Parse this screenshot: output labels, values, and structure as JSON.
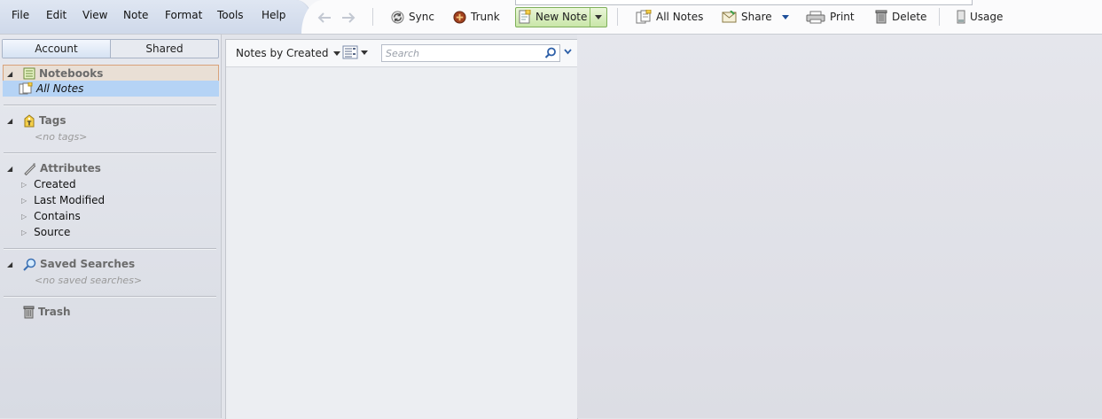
{
  "menubar": {
    "items": [
      "File",
      "Edit",
      "View",
      "Note",
      "Format",
      "Tools",
      "Help"
    ]
  },
  "toolbar": {
    "back_icon": "arrow-left-icon",
    "forward_icon": "arrow-right-icon",
    "sync_label": "Sync",
    "trunk_label": "Trunk",
    "new_note_label": "New Note",
    "all_notes_label": "All Notes",
    "share_label": "Share",
    "print_label": "Print",
    "delete_label": "Delete",
    "usage_label": "Usage"
  },
  "sidebar": {
    "tabs": [
      "Account",
      "Shared"
    ],
    "notebooks": {
      "label": "Notebooks",
      "items": [
        "All Notes"
      ]
    },
    "tags": {
      "label": "Tags",
      "empty": "<no tags>"
    },
    "attributes": {
      "label": "Attributes",
      "items": [
        "Created",
        "Last Modified",
        "Contains",
        "Source"
      ]
    },
    "saved_searches": {
      "label": "Saved Searches",
      "empty": "<no saved searches>"
    },
    "trash": {
      "label": "Trash"
    }
  },
  "notelist": {
    "sort_label": "Notes by Created",
    "search_placeholder": "Search"
  },
  "colors": {
    "selected_row": "#b5d3f5",
    "new_note_green": "#c9e6a8",
    "menubar_blue": "#cfd9ea"
  }
}
